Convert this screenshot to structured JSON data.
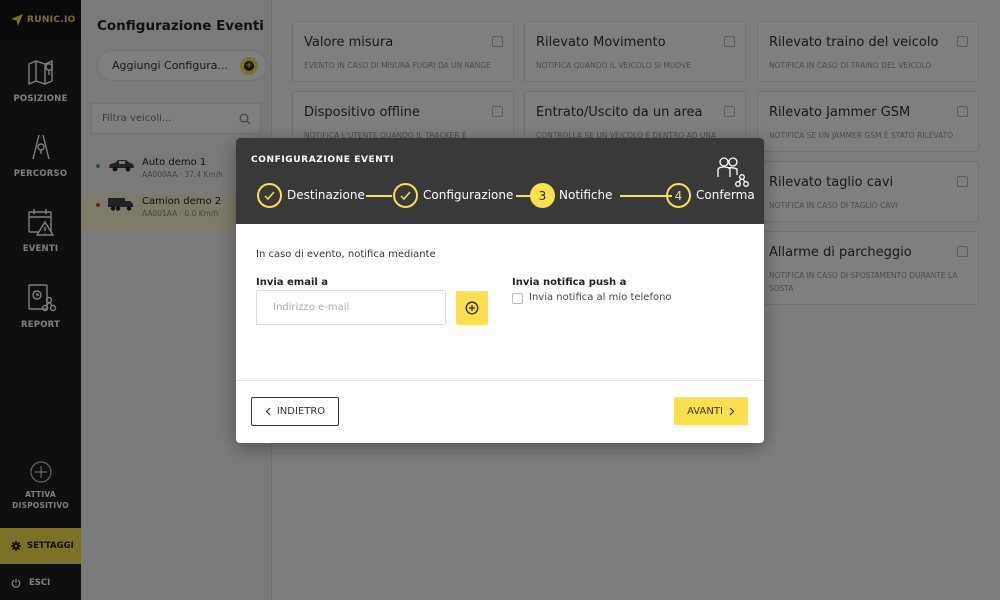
{
  "app": {
    "logo_text": "RUNIC.IO"
  },
  "sidebar": {
    "items": [
      {
        "label": "POSIZIONE",
        "icon": "map-icon"
      },
      {
        "label": "PERCORSO",
        "icon": "route-icon"
      },
      {
        "label": "EVENTI",
        "icon": "calendar-alert-icon"
      },
      {
        "label": "REPORT",
        "icon": "report-share-icon"
      }
    ],
    "activate_line1": "ATTIVA",
    "activate_line2": "DISPOSITIVO",
    "settings": "SETTAGGI",
    "logout": "ESCI"
  },
  "vehicles_panel": {
    "title": "Configurazione Eventi",
    "add_button": "Aggiungi Configura...",
    "filter_placeholder": "Filtra veicoli...",
    "vehicles": [
      {
        "name": "Auto demo 1",
        "sub": "AA000AA · 37.4 Km/h",
        "status_color": "#4caf50",
        "icon": "car-icon"
      },
      {
        "name": "Camion demo 2",
        "sub": "AA001AA · 0.0 Km/h",
        "status_color": "#e53935",
        "icon": "truck-icon"
      }
    ]
  },
  "events": [
    {
      "title": "Valore misura",
      "desc": "EVENTO IN CASO DI MISURA FUORI DA UN RANGE"
    },
    {
      "title": "Rilevato Movimento",
      "desc": "NOTIFICA QUANDO IL VEICOLO SI MUOVE"
    },
    {
      "title": "Rilevato traino del veicolo",
      "desc": "NOTIFICA IN CASO DI TRAINO DEL VEICOLO"
    },
    {
      "title": "Dispositivo offline",
      "desc": "NOTIFICA L'UTENTE QUANDO IL TRACKER È"
    },
    {
      "title": "Entrato/Uscito da un area",
      "desc": "CONTROLLA SE UN VEICOLO È DENTRO AD UNA"
    },
    {
      "title": "Rilevato Jammer GSM",
      "desc": "NOTIFICA SE UN JAMMER GSM È STATO RILEVATO"
    },
    {
      "title": "Rilevato taglio cavi",
      "desc": "NOTIFICA IN CASO DI TAGLIO CAVI"
    },
    {
      "title": "Allarme di parcheggio",
      "desc": "NOTIFICA IN CASO DI SPOSTAMENTO DURANTE LA SOSTA"
    }
  ],
  "modal": {
    "title": "CONFIGURAZIONE EVENTI",
    "steps": [
      {
        "num": "",
        "label": "Destinazione",
        "state": "done"
      },
      {
        "num": "",
        "label": "Configurazione",
        "state": "done"
      },
      {
        "num": "3",
        "label": "Notifiche",
        "state": "active"
      },
      {
        "num": "4",
        "label": "Conferma",
        "state": "pending"
      }
    ],
    "intro": "In caso di evento, notifica mediante",
    "email_label": "Invia email a",
    "email_placeholder": "Indirizzo e-mail",
    "push_label": "Invia notifica push a",
    "push_option": "Invia notifica al mio telefono",
    "back_button": "INDIETRO",
    "next_button": "AVANTI"
  },
  "colors": {
    "accent": "#fbe04e",
    "sidebar": "#1f1f1f",
    "modal_header": "#393939"
  }
}
